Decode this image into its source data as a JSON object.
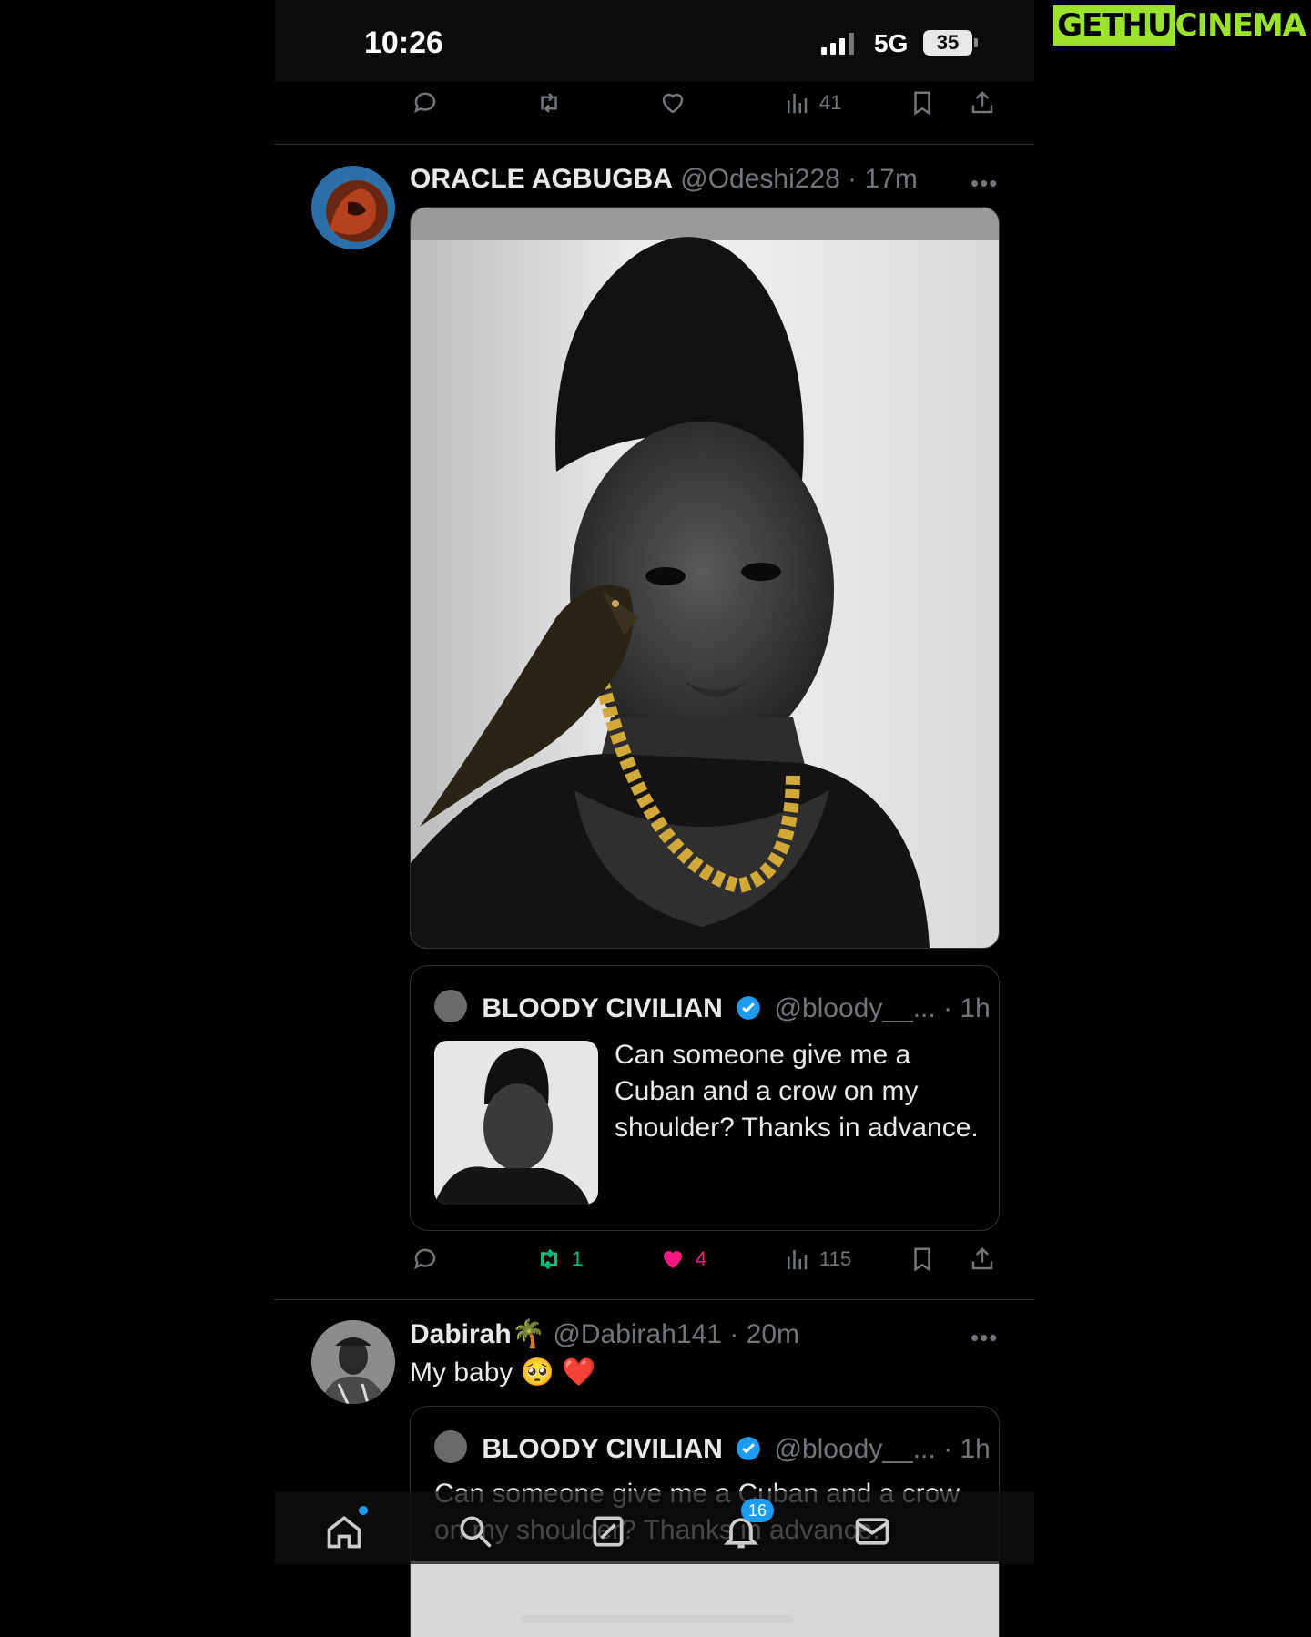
{
  "watermark": {
    "part_a": "GETHU",
    "part_b": "CINEMA"
  },
  "status": {
    "time": "10:26",
    "network": "5G",
    "battery": "35"
  },
  "top_actions": {
    "views": "41"
  },
  "tweet1": {
    "name": "ORACLE AGBUGBA",
    "handle": "@Odeshi228",
    "dot": "·",
    "time": "17m",
    "more": "•••",
    "quote": {
      "name": "BLOODY CIVILIAN",
      "handle": "@bloody__...",
      "time": "1h",
      "text": "Can someone give me a Cuban and a crow on my shoulder? Thanks in advance."
    },
    "actions": {
      "retweets": "1",
      "likes": "4",
      "views": "115"
    }
  },
  "tweet2": {
    "name": "Dabirah🌴",
    "handle": "@Dabirah141",
    "dot": "·",
    "time": "20m",
    "more": "•••",
    "text": "My baby 🥺 ❤️",
    "quote": {
      "name": "BLOODY CIVILIAN",
      "handle": "@bloody__...",
      "time": "1h",
      "text": "Can someone give me a Cuban and a crow on my shoulder? Thanks in advance."
    }
  },
  "nav": {
    "notifications_badge": "16"
  },
  "colors": {
    "retweet_active": "#00ba7c",
    "like_active": "#f91880",
    "verified": "#1d9bf0",
    "muted": "#71767b"
  }
}
